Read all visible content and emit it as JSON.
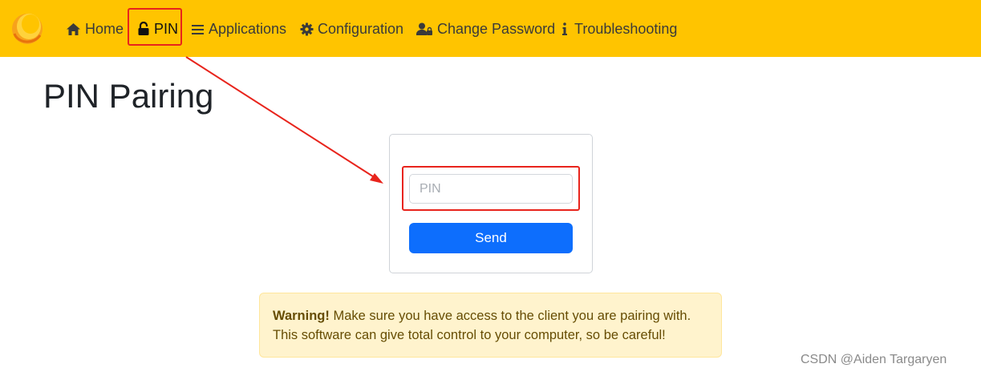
{
  "nav": {
    "items": [
      {
        "label": "Home",
        "icon": "house-icon"
      },
      {
        "label": "PIN",
        "icon": "unlock-icon",
        "active": true
      },
      {
        "label": "Applications",
        "icon": "list-icon"
      },
      {
        "label": "Configuration",
        "icon": "gear-icon"
      },
      {
        "label": "Change Password",
        "icon": "user-lock-icon"
      },
      {
        "label": "Troubleshooting",
        "icon": "info-icon"
      }
    ]
  },
  "page": {
    "title": "PIN Pairing"
  },
  "pin_form": {
    "input_placeholder": "PIN",
    "input_value": "",
    "send_label": "Send"
  },
  "alert": {
    "strong": "Warning!",
    "text": " Make sure you have access to the client you are pairing with. This software can give total control to your computer, so be careful!"
  },
  "watermark": "CSDN @Aiden Targaryen",
  "colors": {
    "navbar": "#ffc400",
    "primary_button": "#0d6efd",
    "annotation_red": "#e8241c",
    "alert_bg": "#fff3cd",
    "alert_text": "#664d03"
  }
}
